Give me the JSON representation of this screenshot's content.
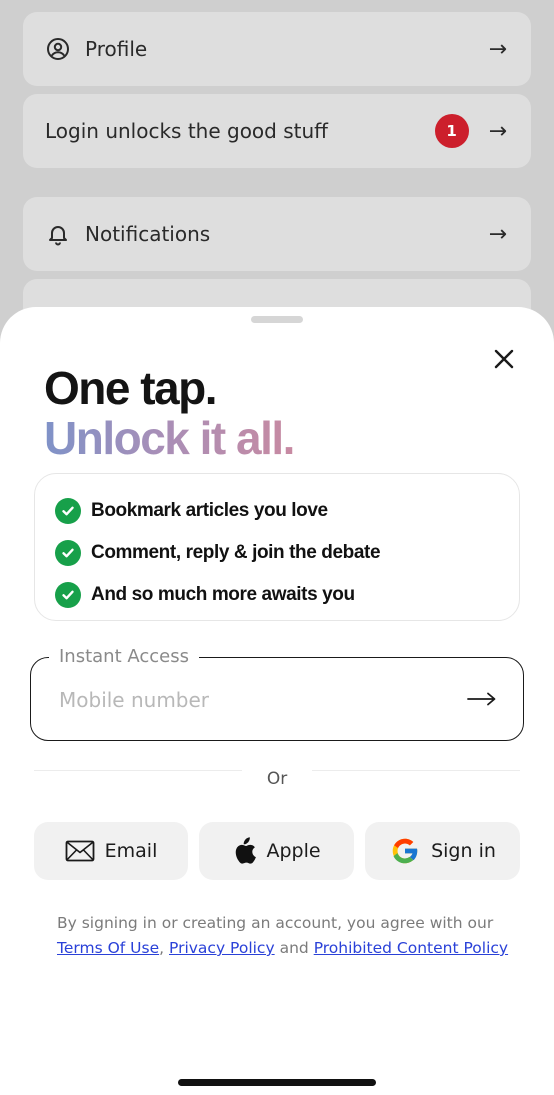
{
  "background_menu": {
    "profile": {
      "label": "Profile",
      "icon": "user-circle-icon"
    },
    "login": {
      "label": "Login unlocks the good stuff",
      "badge": "1"
    },
    "notifications": {
      "label": "Notifications",
      "icon": "bell-icon"
    },
    "arrow": "→"
  },
  "sheet": {
    "headline_line1": "One tap.",
    "headline_line2": "Unlock it all.",
    "benefits": [
      "Bookmark articles you love",
      "Comment, reply & join the debate",
      "And so much more awaits you"
    ],
    "instant_access": {
      "legend": "Instant Access",
      "placeholder": "Mobile number",
      "value": ""
    },
    "or_text": "Or",
    "alt_buttons": {
      "email": "Email",
      "apple": "Apple",
      "google": "Sign in"
    },
    "legal": {
      "prefix": "By signing in or creating an account, you agree with our",
      "terms": "Terms Of Use",
      "comma": ",",
      "privacy": "Privacy Policy",
      "and": "and",
      "prohibited": "Prohibited Content Policy"
    }
  },
  "colors": {
    "badge": "#cc1f2c",
    "check": "#17a04a",
    "link": "#2a41d8",
    "gradient_start": "#7f92c8",
    "gradient_end": "#c88aa2"
  }
}
